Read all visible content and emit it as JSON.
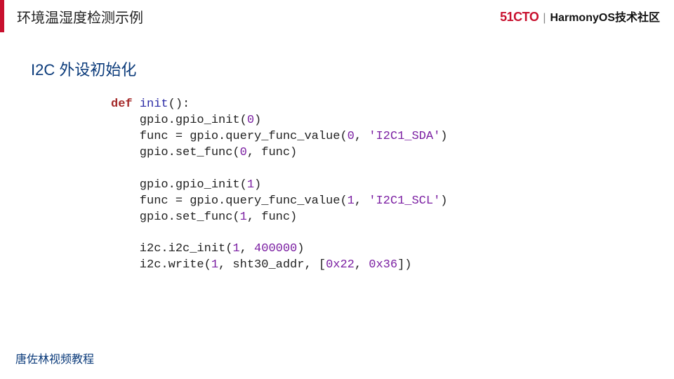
{
  "header": {
    "title": "环境温湿度检测示例",
    "logo": "51CTO",
    "divider": "|",
    "community": "HarmonyOS技术社区"
  },
  "section_title": "I2C 外设初始化",
  "code": {
    "t1": "def",
    "t2": "init",
    "t3": "():",
    "l2a": "    gpio.gpio_init(",
    "l2n": "0",
    "l2b": ")",
    "l3a": "    func = gpio.query_func_value(",
    "l3n": "0",
    "l3b": ", ",
    "l3s": "'I2C1_SDA'",
    "l3c": ")",
    "l4a": "    gpio.set_func(",
    "l4n": "0",
    "l4b": ", func)",
    "blank1": "",
    "l5a": "    gpio.gpio_init(",
    "l5n": "1",
    "l5b": ")",
    "l6a": "    func = gpio.query_func_value(",
    "l6n": "1",
    "l6b": ", ",
    "l6s": "'I2C1_SCL'",
    "l6c": ")",
    "l7a": "    gpio.set_func(",
    "l7n": "1",
    "l7b": ", func)",
    "blank2": "",
    "l8a": "    i2c.i2c_init(",
    "l8n1": "1",
    "l8b": ", ",
    "l8n2": "400000",
    "l8c": ")",
    "l9a": "    i2c.write(",
    "l9n1": "1",
    "l9b": ", sht30_addr, [",
    "l9n2": "0x22",
    "l9c": ", ",
    "l9n3": "0x36",
    "l9d": "])"
  },
  "footer": "唐佐林视频教程"
}
